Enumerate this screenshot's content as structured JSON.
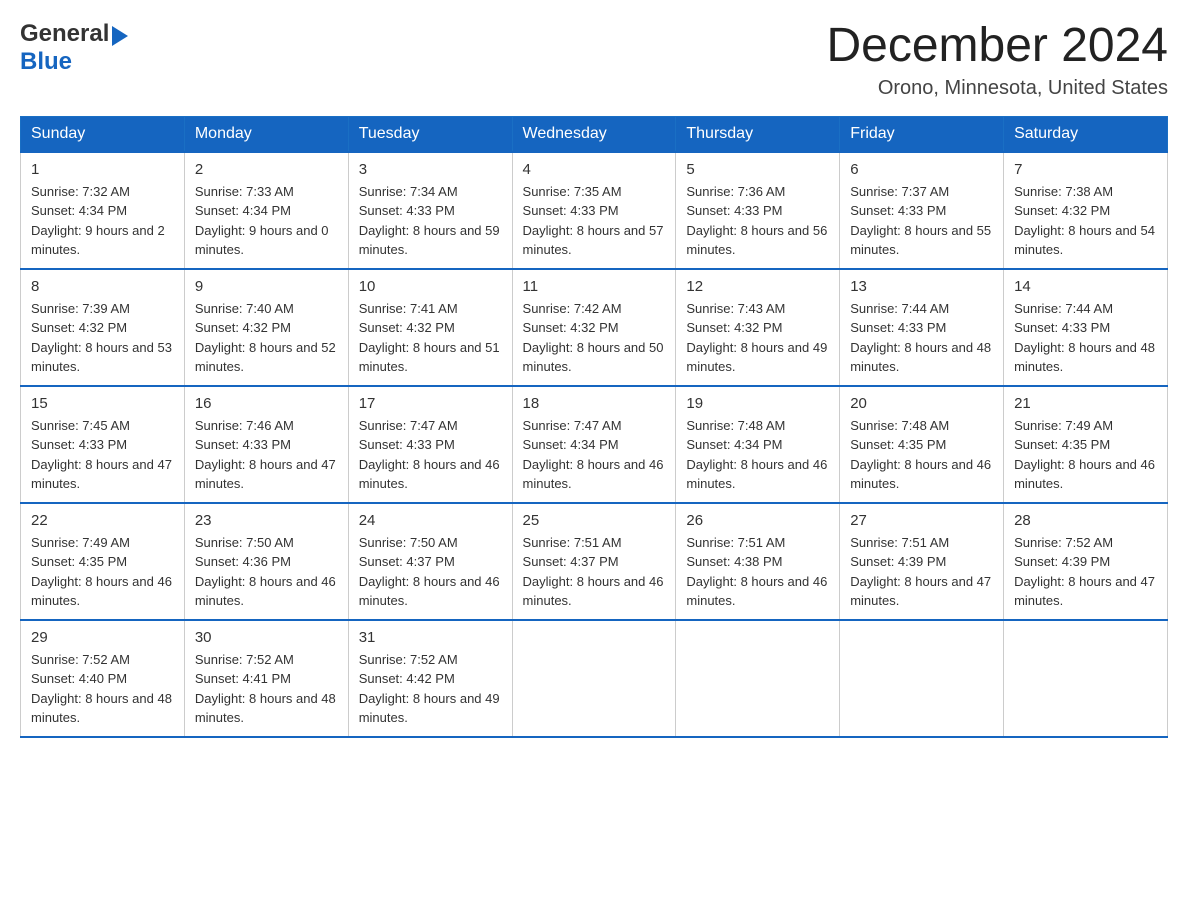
{
  "header": {
    "logo_general": "General",
    "logo_blue": "Blue",
    "month_title": "December 2024",
    "location": "Orono, Minnesota, United States"
  },
  "weekdays": [
    "Sunday",
    "Monday",
    "Tuesday",
    "Wednesday",
    "Thursday",
    "Friday",
    "Saturday"
  ],
  "weeks": [
    [
      {
        "day": "1",
        "sunrise": "7:32 AM",
        "sunset": "4:34 PM",
        "daylight": "9 hours and 2 minutes."
      },
      {
        "day": "2",
        "sunrise": "7:33 AM",
        "sunset": "4:34 PM",
        "daylight": "9 hours and 0 minutes."
      },
      {
        "day": "3",
        "sunrise": "7:34 AM",
        "sunset": "4:33 PM",
        "daylight": "8 hours and 59 minutes."
      },
      {
        "day": "4",
        "sunrise": "7:35 AM",
        "sunset": "4:33 PM",
        "daylight": "8 hours and 57 minutes."
      },
      {
        "day": "5",
        "sunrise": "7:36 AM",
        "sunset": "4:33 PM",
        "daylight": "8 hours and 56 minutes."
      },
      {
        "day": "6",
        "sunrise": "7:37 AM",
        "sunset": "4:33 PM",
        "daylight": "8 hours and 55 minutes."
      },
      {
        "day": "7",
        "sunrise": "7:38 AM",
        "sunset": "4:32 PM",
        "daylight": "8 hours and 54 minutes."
      }
    ],
    [
      {
        "day": "8",
        "sunrise": "7:39 AM",
        "sunset": "4:32 PM",
        "daylight": "8 hours and 53 minutes."
      },
      {
        "day": "9",
        "sunrise": "7:40 AM",
        "sunset": "4:32 PM",
        "daylight": "8 hours and 52 minutes."
      },
      {
        "day": "10",
        "sunrise": "7:41 AM",
        "sunset": "4:32 PM",
        "daylight": "8 hours and 51 minutes."
      },
      {
        "day": "11",
        "sunrise": "7:42 AM",
        "sunset": "4:32 PM",
        "daylight": "8 hours and 50 minutes."
      },
      {
        "day": "12",
        "sunrise": "7:43 AM",
        "sunset": "4:32 PM",
        "daylight": "8 hours and 49 minutes."
      },
      {
        "day": "13",
        "sunrise": "7:44 AM",
        "sunset": "4:33 PM",
        "daylight": "8 hours and 48 minutes."
      },
      {
        "day": "14",
        "sunrise": "7:44 AM",
        "sunset": "4:33 PM",
        "daylight": "8 hours and 48 minutes."
      }
    ],
    [
      {
        "day": "15",
        "sunrise": "7:45 AM",
        "sunset": "4:33 PM",
        "daylight": "8 hours and 47 minutes."
      },
      {
        "day": "16",
        "sunrise": "7:46 AM",
        "sunset": "4:33 PM",
        "daylight": "8 hours and 47 minutes."
      },
      {
        "day": "17",
        "sunrise": "7:47 AM",
        "sunset": "4:33 PM",
        "daylight": "8 hours and 46 minutes."
      },
      {
        "day": "18",
        "sunrise": "7:47 AM",
        "sunset": "4:34 PM",
        "daylight": "8 hours and 46 minutes."
      },
      {
        "day": "19",
        "sunrise": "7:48 AM",
        "sunset": "4:34 PM",
        "daylight": "8 hours and 46 minutes."
      },
      {
        "day": "20",
        "sunrise": "7:48 AM",
        "sunset": "4:35 PM",
        "daylight": "8 hours and 46 minutes."
      },
      {
        "day": "21",
        "sunrise": "7:49 AM",
        "sunset": "4:35 PM",
        "daylight": "8 hours and 46 minutes."
      }
    ],
    [
      {
        "day": "22",
        "sunrise": "7:49 AM",
        "sunset": "4:35 PM",
        "daylight": "8 hours and 46 minutes."
      },
      {
        "day": "23",
        "sunrise": "7:50 AM",
        "sunset": "4:36 PM",
        "daylight": "8 hours and 46 minutes."
      },
      {
        "day": "24",
        "sunrise": "7:50 AM",
        "sunset": "4:37 PM",
        "daylight": "8 hours and 46 minutes."
      },
      {
        "day": "25",
        "sunrise": "7:51 AM",
        "sunset": "4:37 PM",
        "daylight": "8 hours and 46 minutes."
      },
      {
        "day": "26",
        "sunrise": "7:51 AM",
        "sunset": "4:38 PM",
        "daylight": "8 hours and 46 minutes."
      },
      {
        "day": "27",
        "sunrise": "7:51 AM",
        "sunset": "4:39 PM",
        "daylight": "8 hours and 47 minutes."
      },
      {
        "day": "28",
        "sunrise": "7:52 AM",
        "sunset": "4:39 PM",
        "daylight": "8 hours and 47 minutes."
      }
    ],
    [
      {
        "day": "29",
        "sunrise": "7:52 AM",
        "sunset": "4:40 PM",
        "daylight": "8 hours and 48 minutes."
      },
      {
        "day": "30",
        "sunrise": "7:52 AM",
        "sunset": "4:41 PM",
        "daylight": "8 hours and 48 minutes."
      },
      {
        "day": "31",
        "sunrise": "7:52 AM",
        "sunset": "4:42 PM",
        "daylight": "8 hours and 49 minutes."
      },
      null,
      null,
      null,
      null
    ]
  ]
}
